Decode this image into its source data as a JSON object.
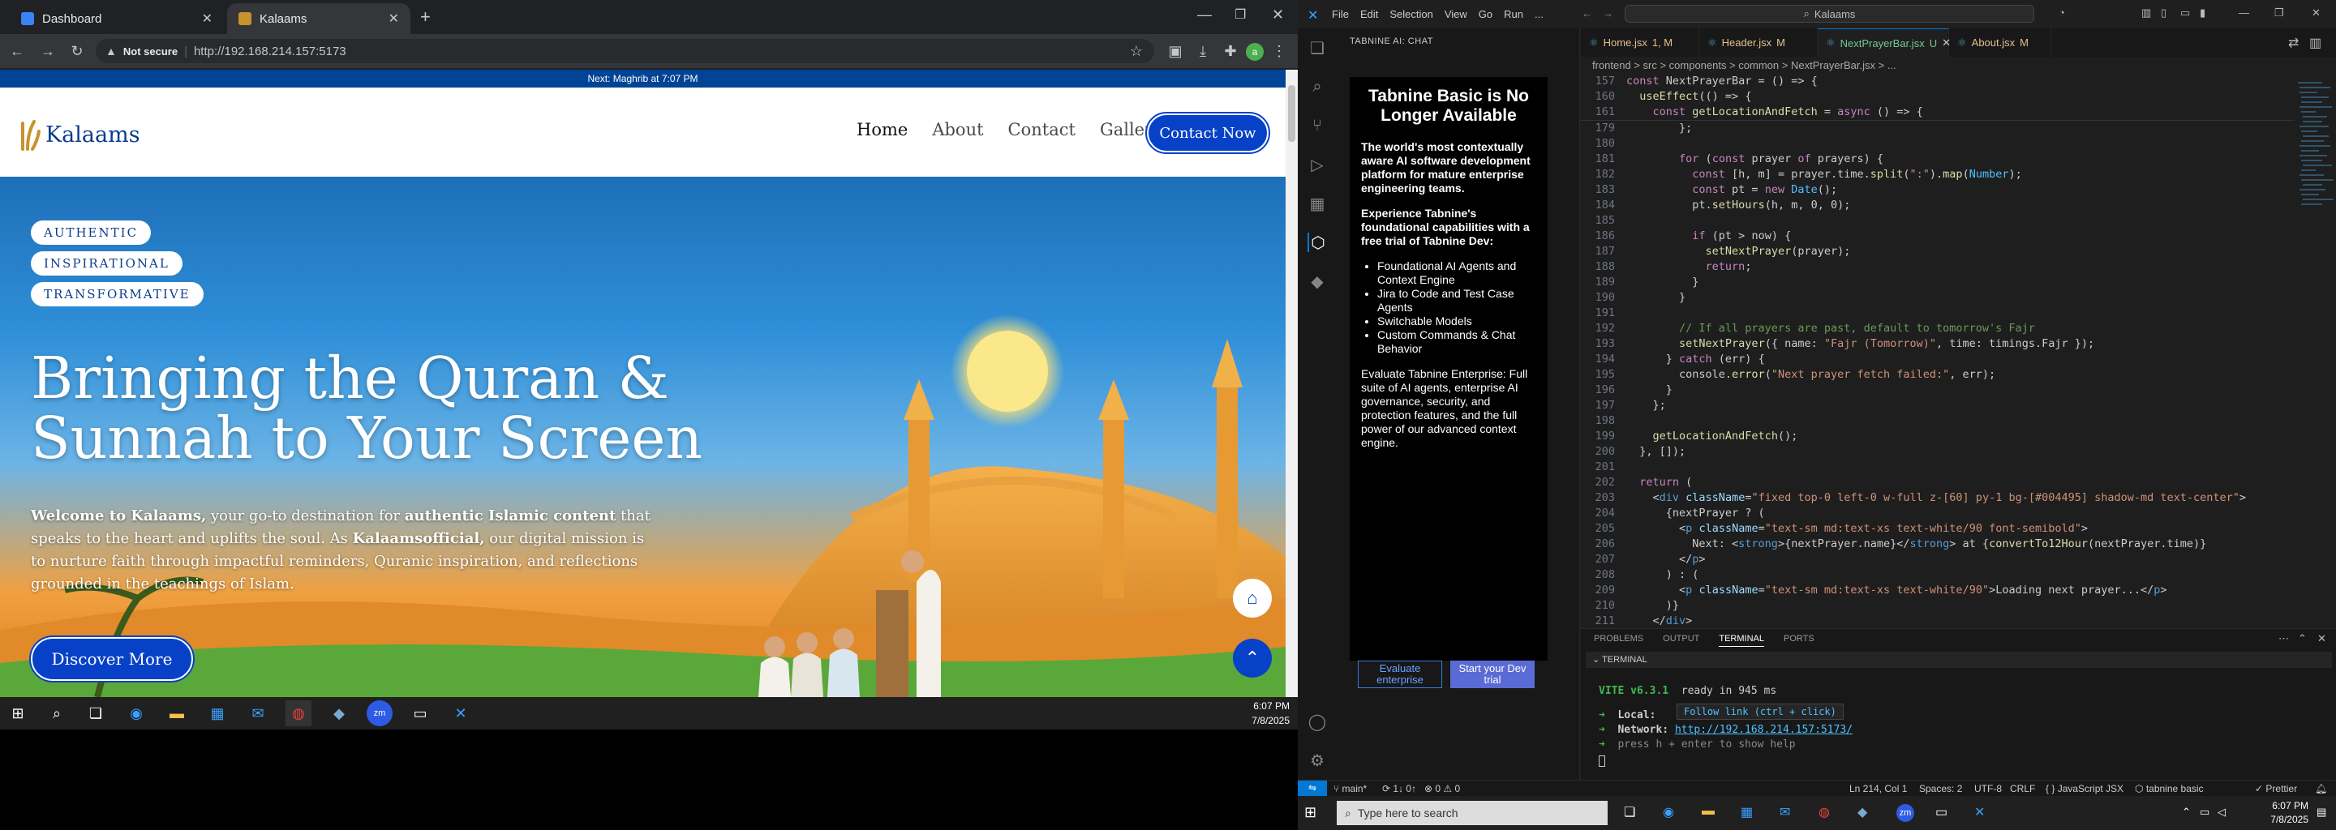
{
  "browser": {
    "tabs": [
      {
        "label": "Dashboard",
        "active": false
      },
      {
        "label": "Kalaams",
        "active": true
      }
    ],
    "not_secure": "Not secure",
    "url": "http://192.168.214.157:5173"
  },
  "site": {
    "prayer_banner": "Next: Maghrib at 7:07 PM",
    "logo_text": "Kalaams",
    "nav": [
      "Home",
      "About",
      "Contact",
      "Gallery"
    ],
    "contact_button": "Contact Now",
    "pills": [
      "AUTHENTIC",
      "INSPIRATIONAL",
      "TRANSFORMATIVE"
    ],
    "headline": "Bringing the Quran & Sunnah to Your Screen",
    "intro": {
      "welcome_bold": "Welcome to Kalaams,",
      "t1": " your go-to destination for ",
      "bold2": "authentic Islamic content",
      "t2": " that speaks to the heart and uplifts the soul. As ",
      "bold3": "Kalaamsofficial,",
      "t3": " our digital mission is to nurture faith through impactful reminders, Quranic inspiration, and reflections grounded in the teachings of Islam."
    },
    "discover_button": "Discover More"
  },
  "taskbar_left": {
    "time": "6:07 PM",
    "date": "7/8/2025"
  },
  "vscode": {
    "menu": [
      "File",
      "Edit",
      "Selection",
      "View",
      "Go",
      "Run",
      "..."
    ],
    "search": "Kalaams",
    "side_title": "TABNINE AI: CHAT",
    "tabnine": {
      "title": "Tabnine Basic is No Longer Available",
      "p1": "The world's most contextually aware AI software development platform for mature enterprise engineering teams.",
      "p2": "Experience Tabnine's foundational capabilities with a free trial of Tabnine Dev:",
      "list": [
        "Foundational AI Agents and Context Engine",
        "Jira to Code and Test Case Agents",
        "Switchable Models",
        "Custom Commands & Chat Behavior"
      ],
      "p3": "Evaluate Tabnine Enterprise: Full suite of AI agents, enterprise AI governance, security, and protection features, and the full power of our advanced context engine.",
      "btn_eval": "Evaluate enterprise",
      "btn_trial": "Start your Dev trial"
    },
    "editor_tabs": [
      {
        "label": "Home.jsx",
        "flag": "1, M",
        "active": false
      },
      {
        "label": "Header.jsx",
        "flag": "M",
        "active": false
      },
      {
        "label": "NextPrayerBar.jsx",
        "flag": "U",
        "active": true
      },
      {
        "label": "About.jsx",
        "flag": "M",
        "active": false
      }
    ],
    "breadcrumb": "frontend > src > components > common > NextPrayerBar.jsx > ...",
    "sticky": [
      {
        "n": "157",
        "code": "const NextPrayerBar = () => {"
      },
      {
        "n": "160",
        "code": "  useEffect(() => {"
      },
      {
        "n": "161",
        "code": "    const getLocationAndFetch = async () => {"
      }
    ],
    "code_lines": [
      {
        "n": "179",
        "code": "        };"
      },
      {
        "n": "180",
        "code": ""
      },
      {
        "n": "181",
        "code": "        for (const prayer of prayers) {"
      },
      {
        "n": "182",
        "code": "          const [h, m] = prayer.time.split(\":\").map(Number);"
      },
      {
        "n": "183",
        "code": "          const pt = new Date();"
      },
      {
        "n": "184",
        "code": "          pt.setHours(h, m, 0, 0);"
      },
      {
        "n": "185",
        "code": ""
      },
      {
        "n": "186",
        "code": "          if (pt > now) {"
      },
      {
        "n": "187",
        "code": "            setNextPrayer(prayer);"
      },
      {
        "n": "188",
        "code": "            return;"
      },
      {
        "n": "189",
        "code": "          }"
      },
      {
        "n": "190",
        "code": "        }"
      },
      {
        "n": "191",
        "code": ""
      },
      {
        "n": "192",
        "code": "        // If all prayers are past, default to tomorrow's Fajr"
      },
      {
        "n": "193",
        "code": "        setNextPrayer({ name: \"Fajr (Tomorrow)\", time: timings.Fajr });"
      },
      {
        "n": "194",
        "code": "      } catch (err) {"
      },
      {
        "n": "195",
        "code": "        console.error(\"Next prayer fetch failed:\", err);"
      },
      {
        "n": "196",
        "code": "      }"
      },
      {
        "n": "197",
        "code": "    };"
      },
      {
        "n": "198",
        "code": ""
      },
      {
        "n": "199",
        "code": "    getLocationAndFetch();"
      },
      {
        "n": "200",
        "code": "  }, []);"
      },
      {
        "n": "201",
        "code": ""
      },
      {
        "n": "202",
        "code": "  return ("
      },
      {
        "n": "203",
        "code": "    <div className=\"fixed top-0 left-0 w-full z-[60] py-1 bg-[#004495] shadow-md text-center\">"
      },
      {
        "n": "204",
        "code": "      {nextPrayer ? ("
      },
      {
        "n": "205",
        "code": "        <p className=\"text-sm md:text-xs text-white/90 font-semibold\">"
      },
      {
        "n": "206",
        "code": "          Next: <strong>{nextPrayer.name}</strong> at {convertTo12Hour(nextPrayer.time)}"
      },
      {
        "n": "207",
        "code": "        </p>"
      },
      {
        "n": "208",
        "code": "      ) : ("
      },
      {
        "n": "209",
        "code": "        <p className=\"text-sm md:text-xs text-white/90\">Loading next prayer...</p>"
      },
      {
        "n": "210",
        "code": "      )}"
      },
      {
        "n": "211",
        "code": "    </div>"
      }
    ],
    "panel_tabs": [
      "PROBLEMS",
      "OUTPUT",
      "TERMINAL",
      "PORTS"
    ],
    "terminal_label": "TERMINAL",
    "terminal": {
      "vite": "VITE v6.3.1",
      "ready": "ready in 945 ms",
      "local_label": "Local:",
      "tooltip": "Follow link (ctrl + click)",
      "network_label": "Network:",
      "network_url": "http://192.168.214.157:5173/",
      "help": "press h + enter to show help"
    },
    "status": {
      "branch": "main*",
      "sync": "1↓ 0↑",
      "problems": "⊗ 0 ⚠ 0",
      "position": "Ln 214, Col 1",
      "spaces": "Spaces: 2",
      "encoding": "UTF-8",
      "eol": "CRLF",
      "language": "JavaScript JSX",
      "tabnine": "tabnine basic",
      "prettier": "✓ Prettier"
    }
  },
  "taskbar_right": {
    "search_placeholder": "Type here to search",
    "time": "6:07 PM",
    "date": "7/8/2025"
  },
  "colors": {
    "brand_blue": "#004495",
    "button_blue": "#0741c8",
    "vscode_accent": "#0078d4"
  }
}
